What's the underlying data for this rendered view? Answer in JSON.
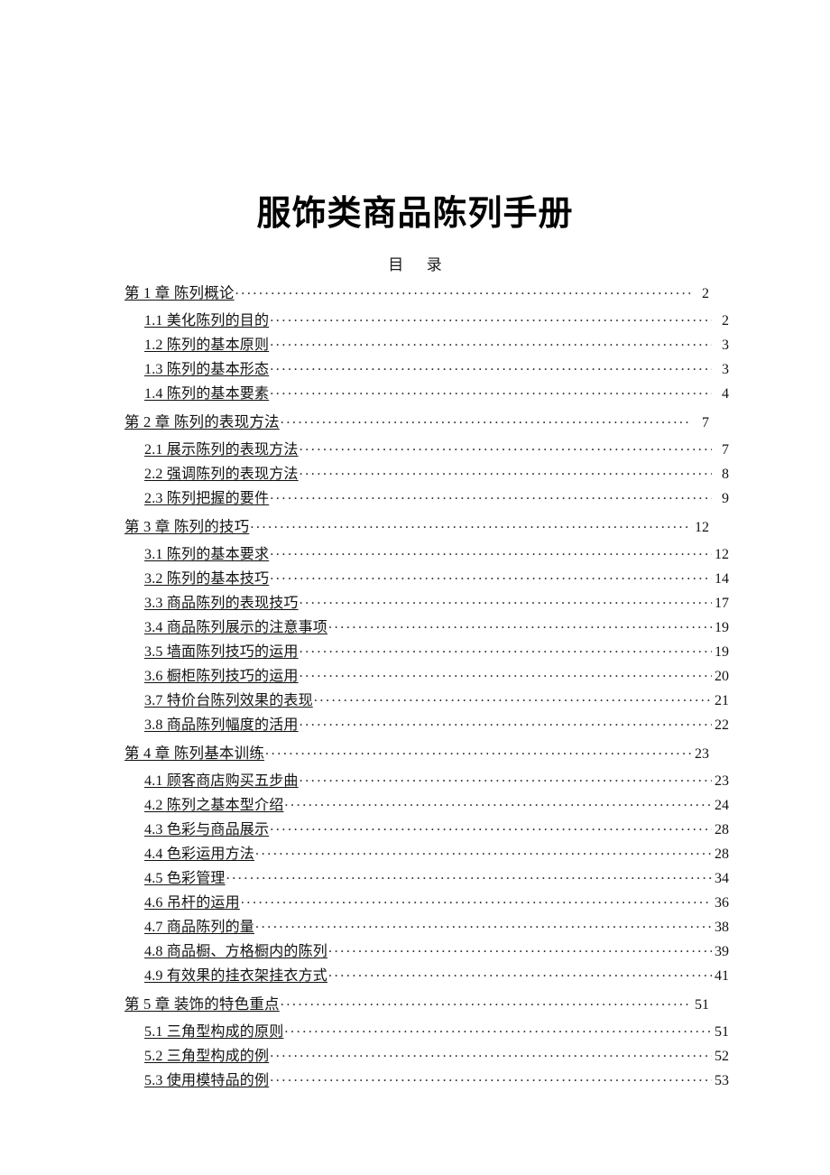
{
  "document": {
    "title": "服饰类商品陈列手册",
    "toc_heading": "目      录"
  },
  "toc": {
    "entries": [
      {
        "level": 1,
        "label": "第 1 章  陈列概论",
        "page": "2",
        "underline": true
      },
      {
        "level": 2,
        "label": "1.1  美化陈列的目的",
        "page": "2",
        "underline": true
      },
      {
        "level": 2,
        "label": "1.2  陈列的基本原则",
        "page": "3",
        "underline": true
      },
      {
        "level": 2,
        "label": "1.3  陈列的基本形态",
        "page": "3",
        "underline": true
      },
      {
        "level": 2,
        "label": "1.4  陈列的基本要素",
        "page": "4",
        "underline": true
      },
      {
        "level": 1,
        "label": "第 2 章  陈列的表现方法",
        "page": "7",
        "underline": true
      },
      {
        "level": 2,
        "label": "2.1  展示陈列的表现方法",
        "page": "7",
        "underline": true
      },
      {
        "level": 2,
        "label": "2.2  强调陈列的表现方法",
        "page": "8",
        "underline": true
      },
      {
        "level": 2,
        "label": "2.3  陈列把握的要件",
        "page": "9",
        "underline": true
      },
      {
        "level": 1,
        "label": "第 3 章  陈列的技巧",
        "page": "12",
        "underline": true
      },
      {
        "level": 2,
        "label": "3.1  陈列的基本要求",
        "page": "12",
        "underline": true
      },
      {
        "level": 2,
        "label": "3.2  陈列的基本技巧",
        "page": "14",
        "underline": true
      },
      {
        "level": 2,
        "label": "3.3  商品陈列的表现技巧",
        "page": "17",
        "underline": true
      },
      {
        "level": 2,
        "label": "3.4  商品陈列展示的注意事项",
        "page": "19",
        "underline": true
      },
      {
        "level": 2,
        "label": "3.5  墙面陈列技巧的运用",
        "page": "19",
        "underline": true
      },
      {
        "level": 2,
        "label": "3.6  橱柜陈列技巧的运用",
        "page": "20",
        "underline": true
      },
      {
        "level": 2,
        "label": "3.7  特价台陈列效果的表现",
        "page": "21",
        "underline": true
      },
      {
        "level": 2,
        "label": "3.8  商品陈列幅度的活用",
        "page": "22",
        "underline": true
      },
      {
        "level": 1,
        "label": "第 4 章  陈列基本训练",
        "page": "23",
        "underline": true
      },
      {
        "level": 2,
        "label": "4.1  顾客商店购买五步曲",
        "page": "23",
        "underline": true
      },
      {
        "level": 2,
        "label": "4.2  陈列之基本型介绍",
        "page": "24",
        "underline": true
      },
      {
        "level": 2,
        "label": "4.3  色彩与商品展示",
        "page": "28",
        "underline": true
      },
      {
        "level": 2,
        "label": "4.4  色彩运用方法",
        "page": "28",
        "underline": true
      },
      {
        "level": 2,
        "label": "4.5  色彩管理",
        "page": "34",
        "underline": true
      },
      {
        "level": 2,
        "label": "4.6  吊杆的运用",
        "page": "36",
        "underline": true
      },
      {
        "level": 2,
        "label": "4.7  商品陈列的量",
        "page": "38",
        "underline": true
      },
      {
        "level": 2,
        "label": "4.8  商品橱、方格橱内的陈列",
        "page": "39",
        "underline": true
      },
      {
        "level": 2,
        "label": "4.9  有效果的挂衣架挂衣方式",
        "page": "41",
        "underline": true
      },
      {
        "level": 1,
        "label": "第 5 章  装饰的特色重点",
        "page": "51",
        "underline": true
      },
      {
        "level": 2,
        "label": "5.1  三角型构成的原则",
        "page": "51",
        "underline": true
      },
      {
        "level": 2,
        "label": "5.2  三角型构成的例",
        "page": "52",
        "underline": true
      },
      {
        "level": 2,
        "label": "5.3  使用模特品的例",
        "page": "53",
        "underline": true
      }
    ]
  }
}
